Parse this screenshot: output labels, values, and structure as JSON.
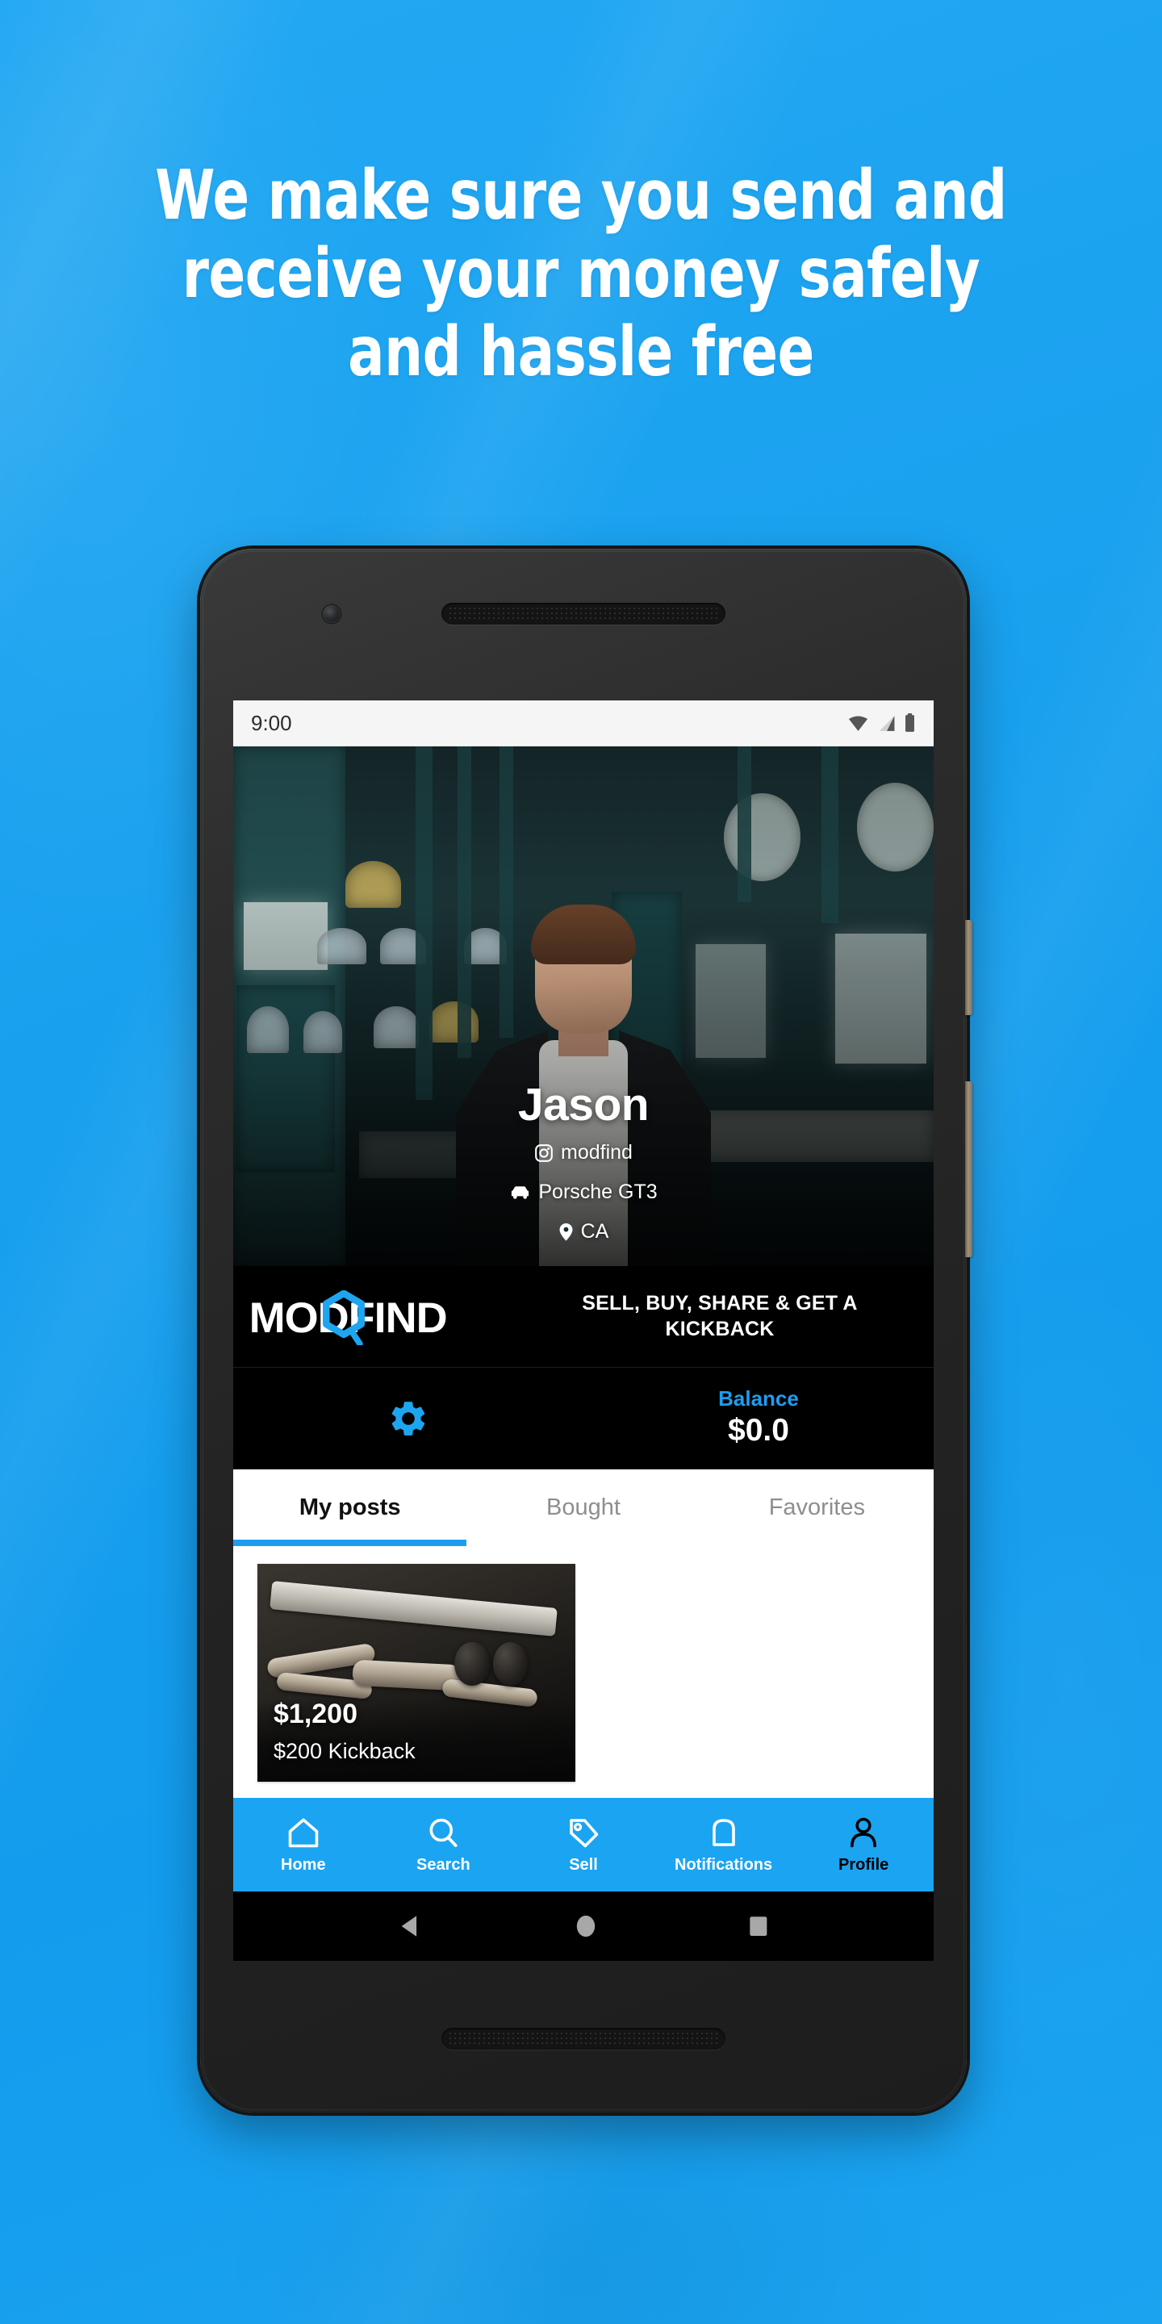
{
  "headline": {
    "lines": [
      "We make sure you send and",
      "receive your money safely",
      "and hassle free"
    ]
  },
  "colors": {
    "background_blue": "#1ca2f0",
    "accent_blue": "#1d9df0",
    "nav_blue": "#1ba4f2",
    "bar_black": "#000000",
    "white": "#ffffff",
    "tab_inactive": "#8e8e8e"
  },
  "phone": {
    "status_bar": {
      "time": "9:00",
      "icons": [
        "wifi-icon",
        "cell-signal-icon",
        "battery-icon"
      ]
    },
    "hardware": {
      "front_camera": "front-camera",
      "top_speaker": "earpiece-speaker",
      "bottom_speaker": "bottom-speaker",
      "power_button": "power-button",
      "volume_button": "volume-button"
    },
    "android_nav": {
      "back": "back-triangle-icon",
      "home": "home-circle-icon",
      "recents": "recents-square-icon"
    }
  },
  "profile": {
    "name": "Jason",
    "handle": "modfind",
    "handle_icon": "instagram-icon",
    "car": "Porsche GT3",
    "car_icon": "car-icon",
    "location": "CA",
    "location_icon": "location-pin-icon"
  },
  "brand": {
    "wordmark": "MODFIND",
    "logo_icon": "hex-magnifier-icon",
    "tagline_line1": "SELL, BUY, SHARE & GET A",
    "tagline_line2": "KICKBACK"
  },
  "account_bar": {
    "settings_icon": "gear-icon",
    "balance_label": "Balance",
    "balance_value": "$0.0"
  },
  "tabs": [
    {
      "label": "My posts",
      "active": true
    },
    {
      "label": "Bought",
      "active": false
    },
    {
      "label": "Favorites",
      "active": false
    }
  ],
  "posts": [
    {
      "price": "$1,200",
      "kickback": "$200 Kickback",
      "image_alt": "car-exhaust-system-photo"
    }
  ],
  "bottom_nav": [
    {
      "label": "Home",
      "icon": "home-icon",
      "active": false
    },
    {
      "label": "Search",
      "icon": "search-icon",
      "active": false
    },
    {
      "label": "Sell",
      "icon": "tag-icon",
      "active": false
    },
    {
      "label": "Notifications",
      "icon": "bell-icon",
      "active": false
    },
    {
      "label": "Profile",
      "icon": "person-icon",
      "active": true
    }
  ]
}
